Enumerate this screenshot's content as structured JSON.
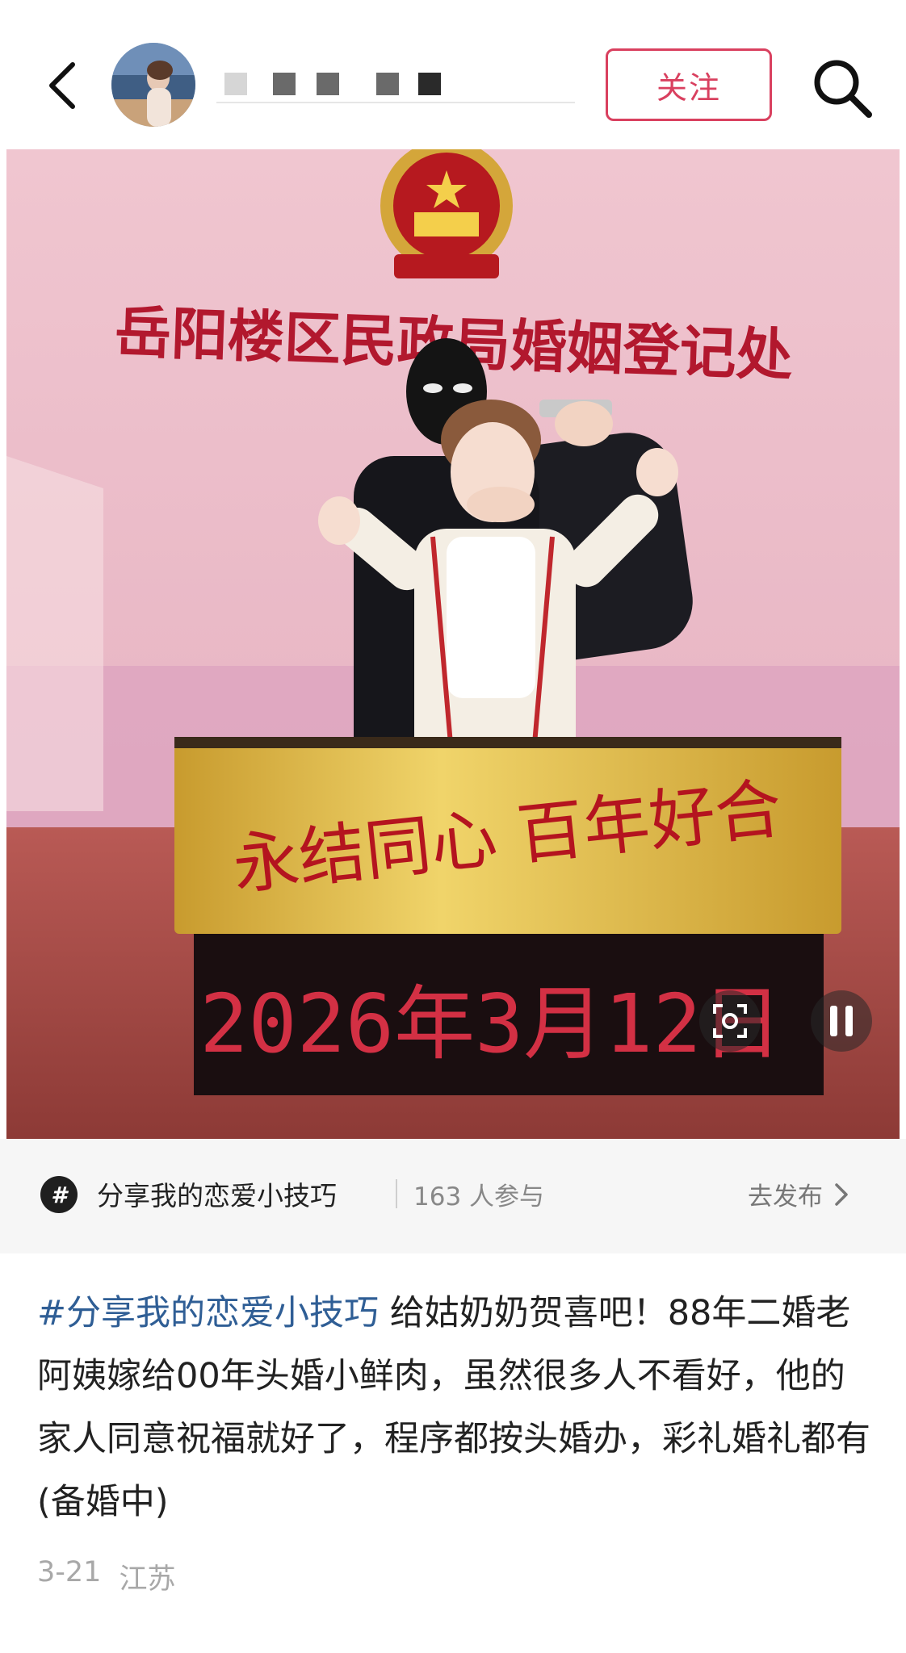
{
  "header": {
    "back_icon": "chevron-left-icon",
    "avatar_icon": "avatar-image",
    "username_mask_colors": [
      "#d6d6d6",
      "#6a6a6a",
      "#6a6a6a",
      "#6a6a6a",
      "#2a2a2a"
    ],
    "follow_label": "关注",
    "search_icon": "search-icon",
    "accent": "#d9405f"
  },
  "media": {
    "wall_sign": "岳阳楼区民政局婚姻登记处",
    "plaque_text": "永结同心 百年好合",
    "led_date": "2026年3月12日",
    "progress": 0.57,
    "screenshot_icon": "screenshot-scan-icon",
    "pause_icon": "pause-icon"
  },
  "topic": {
    "icon": "hashtag-icon",
    "name": "分享我的恋爱小技巧",
    "participants": "163 人参与",
    "action": "去发布"
  },
  "caption": {
    "hashtag": "#分享我的恋爱小技巧",
    "text": " 给姑奶奶贺喜吧！88年二婚老阿姨嫁给00年头婚小鲜肉，虽然很多人不看好，他的家人同意祝福就好了，程序都按头婚办，彩礼婚礼都有(备婚中)"
  },
  "meta": {
    "date": "3-21",
    "location": "江苏"
  }
}
